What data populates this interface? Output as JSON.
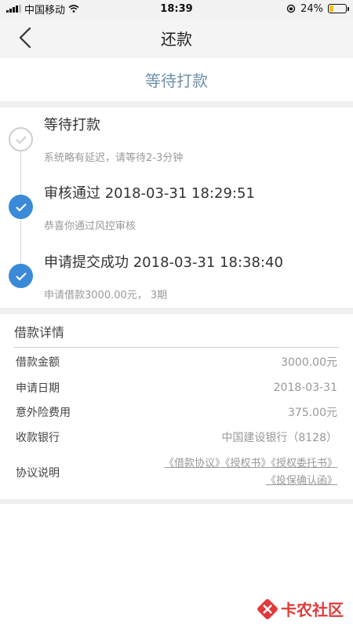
{
  "status_bar": {
    "carrier": "中国移动",
    "time": "18:39",
    "battery": "24%",
    "battery_level": 0.24
  },
  "nav": {
    "title": "还款"
  },
  "status_header": "等待打款",
  "timeline": [
    {
      "title": "等待打款",
      "desc": "系统略有延迟，请等待2-3分钟",
      "state": "pending"
    },
    {
      "title": "审核通过 2018-03-31 18:29:51",
      "desc": "恭喜你通过风控审核",
      "state": "done"
    },
    {
      "title": "申请提交成功 2018-03-31 18:38:40",
      "desc": "申请借款3000.00元， 3期",
      "state": "done"
    }
  ],
  "details": {
    "title": "借款详情",
    "rows": [
      {
        "label": "借款金额",
        "value": "3000.00元"
      },
      {
        "label": "申请日期",
        "value": "2018-03-31"
      },
      {
        "label": "意外险费用",
        "value": "375.00元"
      },
      {
        "label": "收款银行",
        "value": "中国建设银行（8128）"
      }
    ],
    "agreement_label": "协议说明",
    "agreements": [
      "《借款协议》",
      "《授权书》",
      "《授权委托书》",
      "《投保确认函》"
    ]
  },
  "watermark": "卡农社区",
  "colors": {
    "accent_blue": "#3a8ad8",
    "header_text": "#6f8fa8",
    "watermark_red": "#e03a3a"
  }
}
